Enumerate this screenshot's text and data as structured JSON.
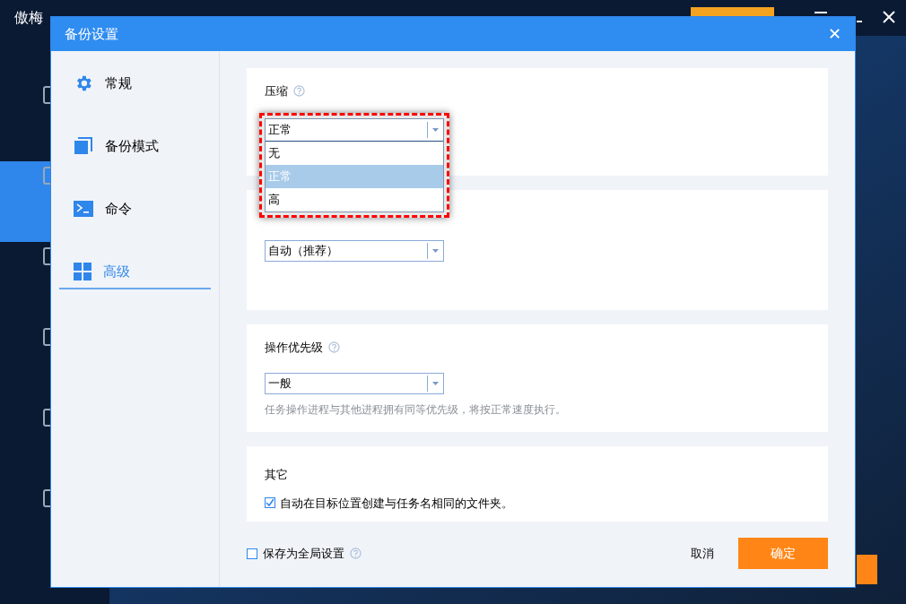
{
  "app": {
    "title": "傲梅",
    "sidebar": [
      {
        "selected": false
      },
      {
        "selected": true
      },
      {
        "selected": false
      },
      {
        "selected": false
      },
      {
        "selected": false
      },
      {
        "selected": false
      }
    ]
  },
  "dialog": {
    "title": "备份设置",
    "close": "✕",
    "nav": [
      {
        "label": "常规",
        "selected": false
      },
      {
        "label": "备份模式",
        "selected": false
      },
      {
        "label": "命令",
        "selected": false
      },
      {
        "label": "高级",
        "selected": true
      }
    ],
    "sections": [
      {
        "title": "压缩",
        "value": "正常",
        "options": [
          {
            "label": "无",
            "selected": false
          },
          {
            "label": "正常",
            "selected": true
          },
          {
            "label": "高",
            "selected": false
          }
        ]
      },
      {
        "value": "自动（推荐）"
      },
      {
        "title": "操作优先级",
        "value": "一般",
        "note": "任务操作进程与其他进程拥有同等优先级，将按正常速度执行。"
      },
      {
        "title": "其它",
        "checkbox": {
          "label": "自动在目标位置创建与任务名相同的文件夹。",
          "checked": true
        }
      }
    ],
    "footer": {
      "global": {
        "label": "保存为全局设置",
        "checked": false
      },
      "cancel": "取消",
      "ok": "确定"
    }
  }
}
